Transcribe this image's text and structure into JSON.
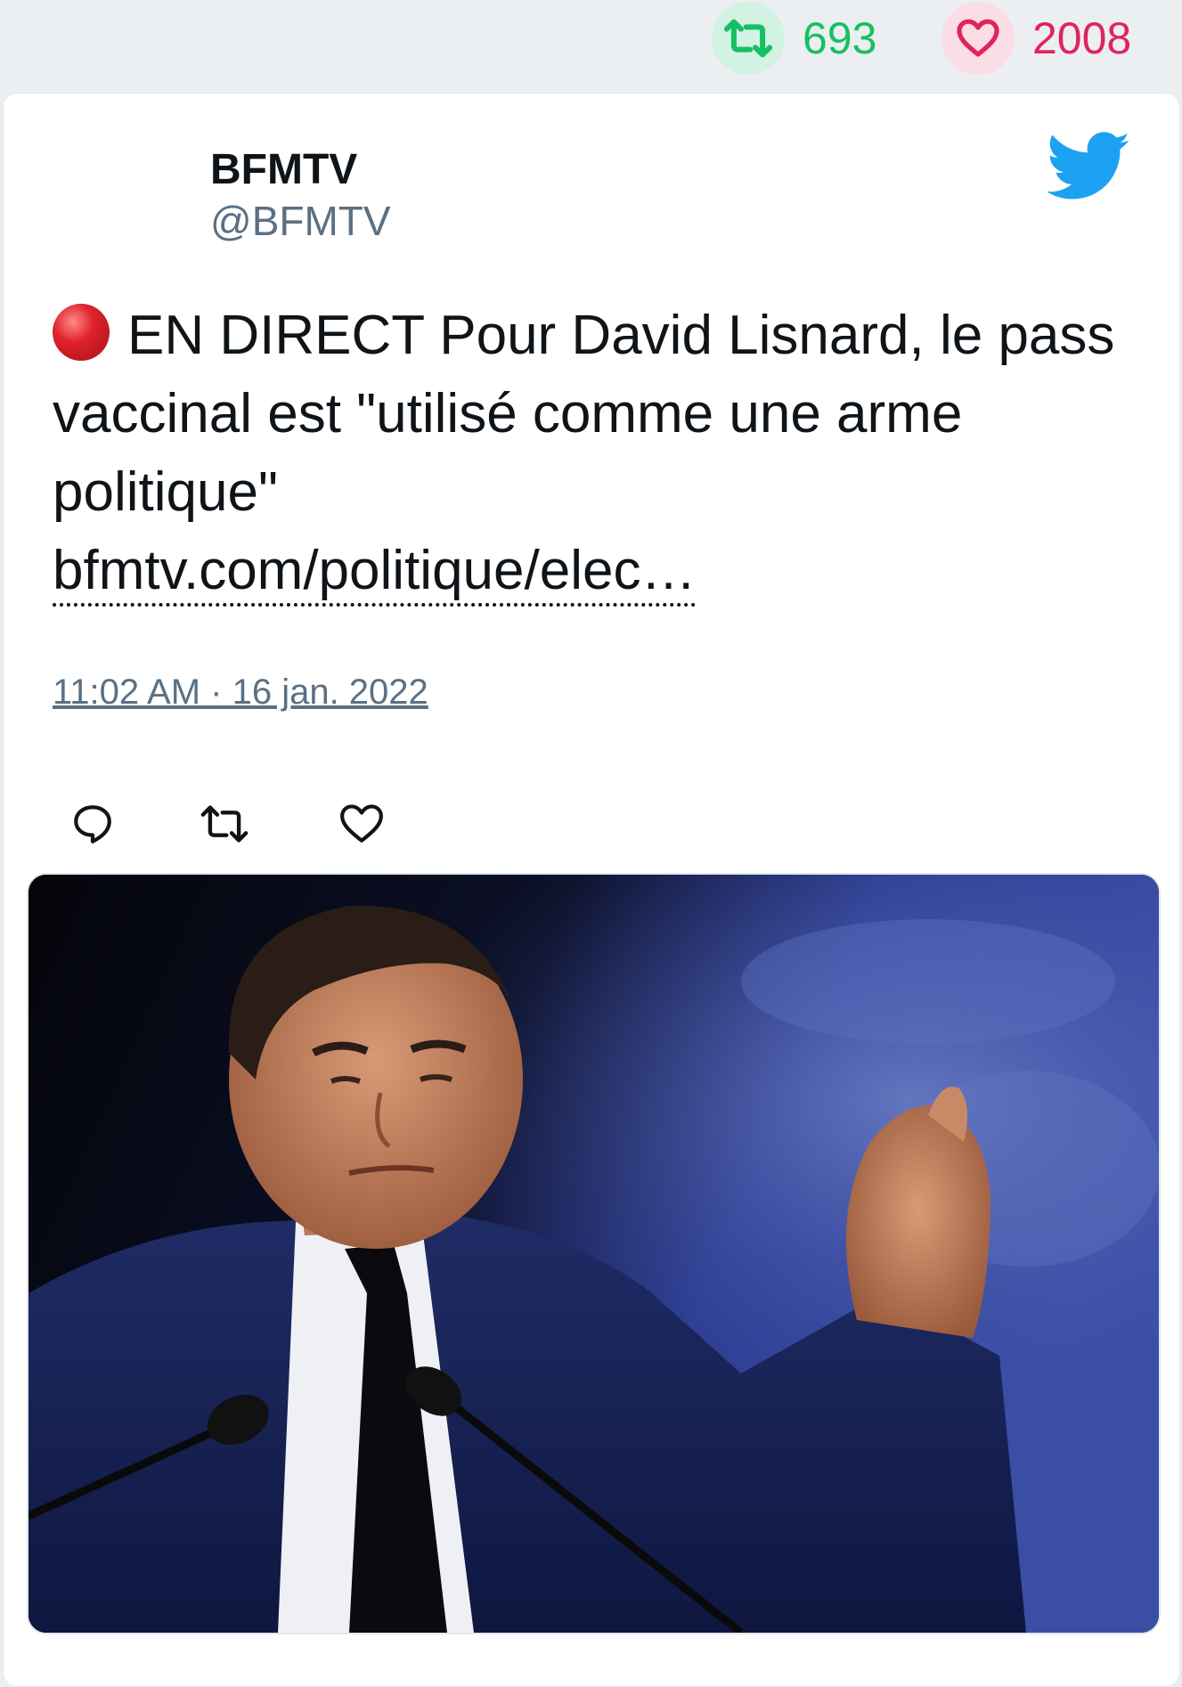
{
  "stats": {
    "retweet_count": "693",
    "like_count": "2008",
    "retweet_icon": "retweet-icon",
    "like_icon": "heart-icon"
  },
  "tweet": {
    "author_name": "BFMTV",
    "author_handle": "@BFMTV",
    "live_icon": "red-circle-emoji",
    "text": "EN DIRECT Pour David Lisnard, le pass vaccinal est \"utilisé comme une arme politique\"",
    "link_text": "bfmtv.com/politique/elec…",
    "timestamp": "11:02 AM · 16 jan. 2022",
    "platform_icon": "twitter-bird-icon"
  },
  "actions": [
    {
      "name": "reply",
      "icon": "reply-icon"
    },
    {
      "name": "retweet",
      "icon": "retweet-icon"
    },
    {
      "name": "like",
      "icon": "heart-icon"
    }
  ],
  "media": {
    "type": "photo",
    "icon": "photo-man-at-podium"
  },
  "colors": {
    "retweet_green": "#17bf63",
    "like_pink": "#e0245e",
    "twitter_blue": "#1da1f2",
    "secondary_text": "#5b7083",
    "background": "#eceff2"
  }
}
